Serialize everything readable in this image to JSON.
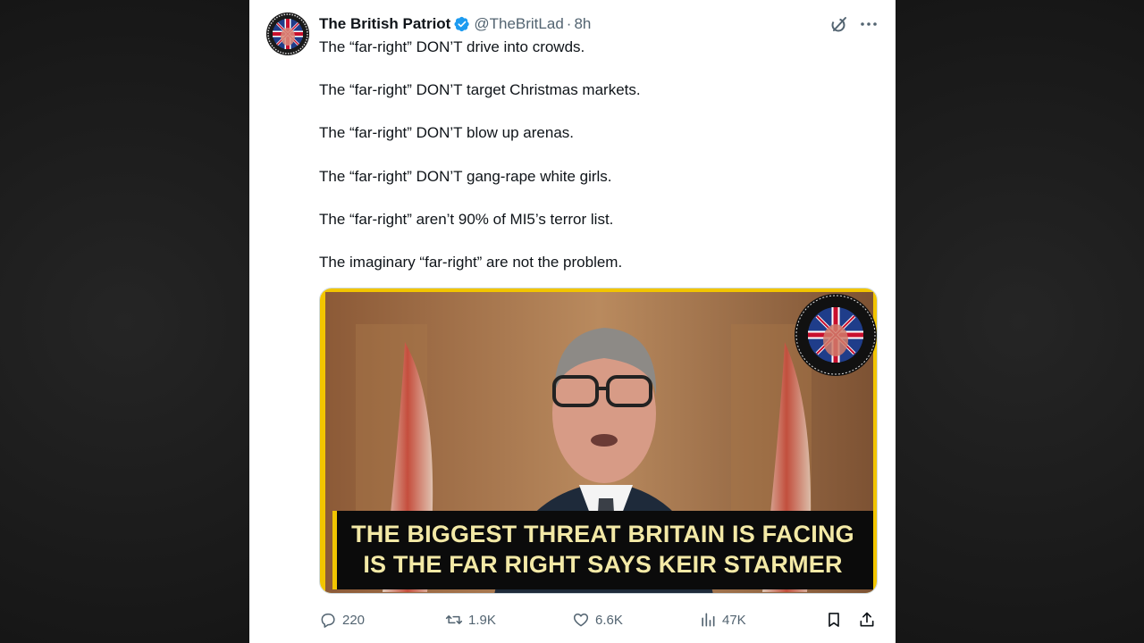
{
  "tweet": {
    "display_name": "The British Patriot",
    "handle": "@TheBritLad",
    "separator": "·",
    "time": "8h",
    "lines": [
      "The “far-right” DON’T drive into crowds.",
      "The “far-right” DON’T target Christmas markets.",
      "The “far-right” DON’T blow up arenas.",
      "The “far-right” DON’T gang-rape white girls.",
      "The “far-right” aren’t 90% of MI5’s terror list.",
      "The imaginary “far-right” are not the problem."
    ],
    "media": {
      "caption_line1": "THE BIGGEST THREAT BRITAIN IS FACING",
      "caption_line2": "IS THE FAR RIGHT SAYS KEIR STARMER",
      "badge_text": "BRITISH AND PROUD · BRITAIN IS FOR THE BRITISH"
    },
    "actions": {
      "replies": "220",
      "reposts": "1.9K",
      "likes": "6.6K",
      "views": "47K"
    }
  },
  "colors": {
    "text": "#0f1419",
    "secondary": "#536471",
    "verified": "#1d9bf0",
    "caption_text": "#f3e9a6",
    "frame_yellow": "#f2c500"
  },
  "icons": [
    "grok-icon",
    "more-icon",
    "verified-badge-icon",
    "reply-icon",
    "retweet-icon",
    "like-icon",
    "views-icon",
    "bookmark-icon",
    "share-icon"
  ]
}
